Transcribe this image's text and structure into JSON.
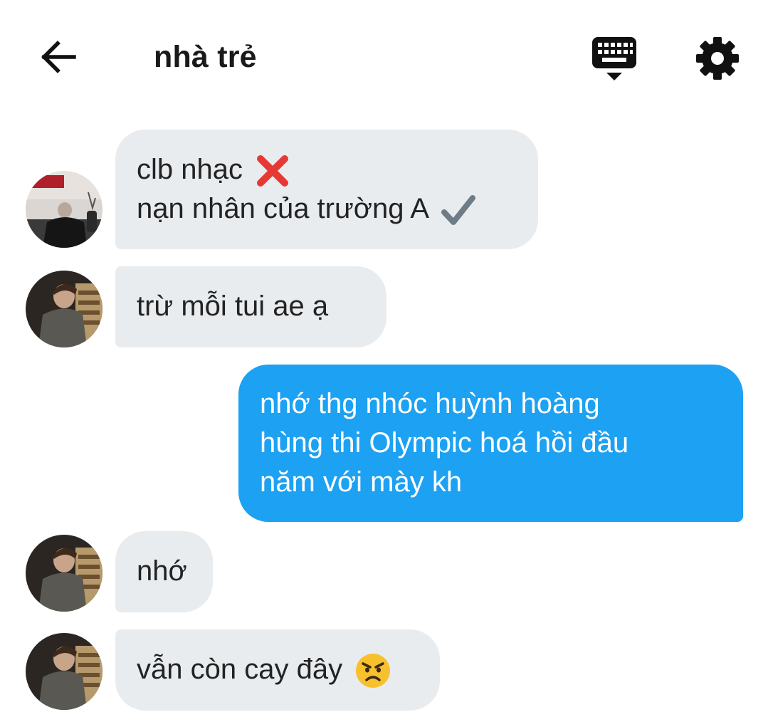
{
  "header": {
    "title": "nhà trẻ",
    "back_icon": "arrow-left-icon",
    "keyboard_icon": "keyboard-hide-icon",
    "settings_icon": "gear-icon"
  },
  "colors": {
    "incoming_bubble": "#e9ecef",
    "outgoing_bubble": "#1da1f2",
    "outgoing_text": "#ffffff"
  },
  "messages": [
    {
      "direction": "incoming",
      "lines": [
        "clb nhạc",
        "nạn nhân của trường A"
      ],
      "emojis": [
        "cross-mark-emoji",
        "check-mark-emoji"
      ]
    },
    {
      "direction": "incoming",
      "lines": [
        "trừ mỗi tui ae ạ"
      ]
    },
    {
      "direction": "outgoing",
      "lines": [
        "nhớ thg nhóc huỳnh hoàng",
        "hùng thi Olympic hoá hồi đầu",
        "năm với mày kh"
      ]
    },
    {
      "direction": "incoming",
      "lines": [
        "nhớ"
      ]
    },
    {
      "direction": "incoming",
      "lines": [
        "vẫn còn cay đây"
      ],
      "emojis": [
        "angry-face-emoji"
      ]
    }
  ]
}
